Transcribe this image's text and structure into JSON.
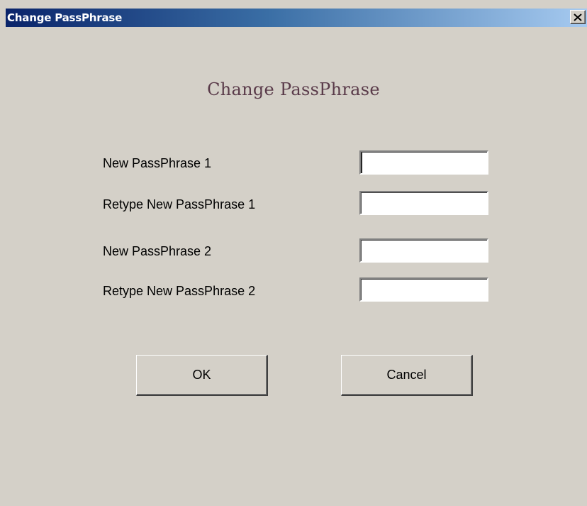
{
  "window": {
    "title": "Change PassPhrase",
    "close_icon": "close-icon"
  },
  "dialog": {
    "heading": "Change PassPhrase",
    "fields": [
      {
        "label": "New PassPhrase 1",
        "value": "",
        "placeholder": ""
      },
      {
        "label": "Retype New PassPhrase 1",
        "value": "",
        "placeholder": ""
      },
      {
        "label": "New PassPhrase 2",
        "value": "",
        "placeholder": ""
      },
      {
        "label": "Retype New PassPhrase 2",
        "value": "",
        "placeholder": ""
      }
    ],
    "ok_label": "OK",
    "cancel_label": "Cancel"
  },
  "colors": {
    "background": "#d4d0c8",
    "titlebar_start": "#0a246a",
    "titlebar_end": "#a6caf0",
    "heading": "#5a3b4a"
  }
}
